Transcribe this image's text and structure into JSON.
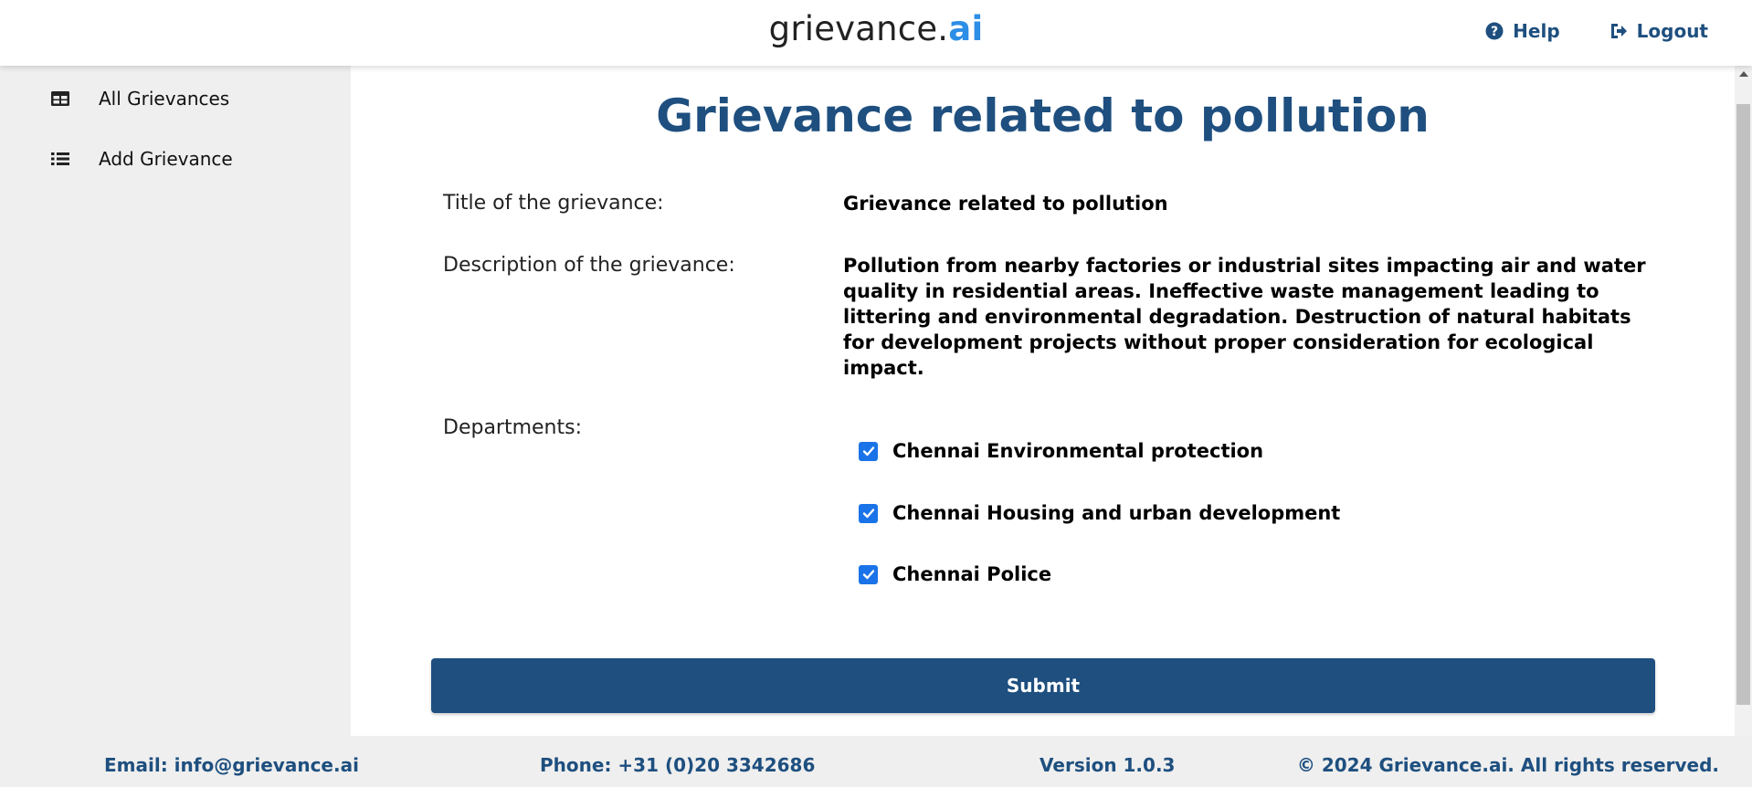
{
  "header": {
    "brand_main": "grievance.",
    "brand_accent": "ai",
    "help_label": "Help",
    "logout_label": "Logout"
  },
  "sidebar": {
    "items": [
      {
        "label": "All Grievances",
        "icon": "table-icon"
      },
      {
        "label": "Add Grievance",
        "icon": "list-icon"
      }
    ]
  },
  "main": {
    "page_title": "Grievance related to pollution",
    "title_label": "Title of the grievance:",
    "title_value": "Grievance related to pollution",
    "description_label": "Description of the grievance:",
    "description_value": "Pollution from nearby factories or industrial sites impacting air and water quality in residential areas. Ineffective waste management leading to littering and environmental degradation. Destruction of natural habitats for development projects without proper consideration for ecological impact.",
    "departments_label": "Departments:",
    "departments": [
      {
        "label": "Chennai Environmental protection",
        "checked": true
      },
      {
        "label": "Chennai Housing and urban development",
        "checked": true
      },
      {
        "label": "Chennai Police",
        "checked": true
      }
    ],
    "submit_label": "Submit"
  },
  "footer": {
    "email": "Email: info@grievance.ai",
    "phone": "Phone: +31 (0)20 3342686",
    "version": "Version 1.0.3",
    "copyright": "© 2024 Grievance.ai. All rights reserved."
  },
  "colors": {
    "primary": "#1e4f7f",
    "accent": "#2d8ee6",
    "checkbox": "#1a73e8",
    "sidebar_bg": "#efefef"
  }
}
